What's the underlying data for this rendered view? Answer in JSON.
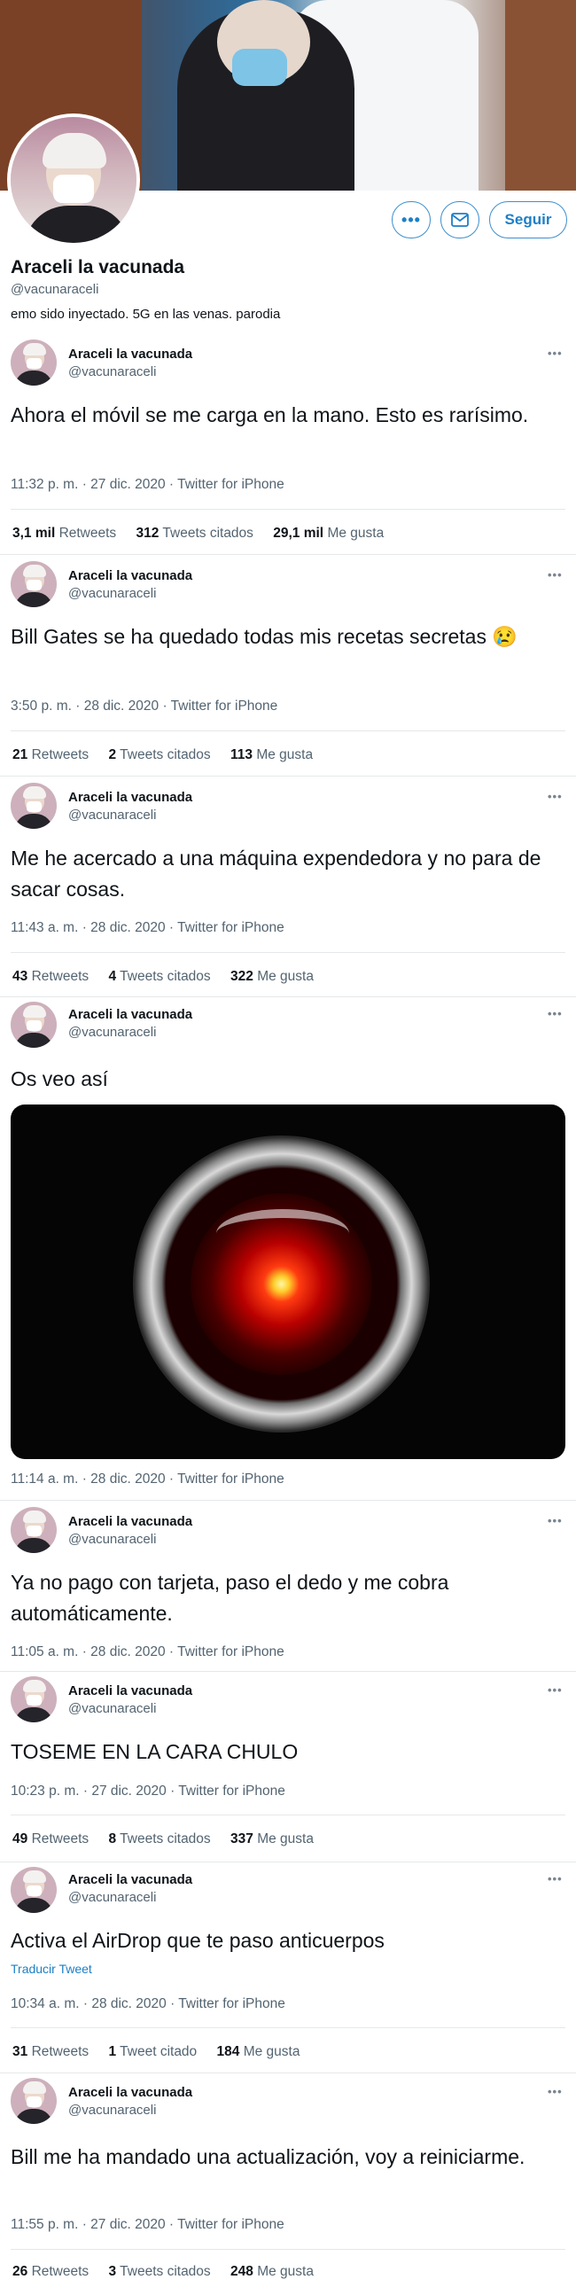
{
  "profile": {
    "name": "Araceli la vacunada",
    "handle": "@vacunaraceli",
    "bio": "emo sido inyectado. 5G en las venas. parodia",
    "follow_label": "Seguir",
    "more_label": "•••"
  },
  "tweets": [
    {
      "name": "Araceli la vacunada",
      "handle": "@vacunaraceli",
      "text": "Ahora el móvil se me carga en la mano. Esto es rarísimo.",
      "meta": "11:32 p. m. · 27 dic. 2020 · Twitter for iPhone",
      "retweets": "3,1 mil",
      "retweets_label": "Retweets",
      "quotes": "312",
      "quotes_label": "Tweets citados",
      "likes": "29,1 mil",
      "likes_label": "Me gusta"
    },
    {
      "name": "Araceli la vacunada",
      "handle": "@vacunaraceli",
      "text": "Bill Gates se ha quedado todas mis recetas secretas 😢",
      "meta": "3:50 p. m. · 28 dic. 2020 · Twitter for iPhone",
      "retweets": "21",
      "retweets_label": "Retweets",
      "quotes": "2",
      "quotes_label": "Tweets citados",
      "likes": "113",
      "likes_label": "Me gusta"
    },
    {
      "name": "Araceli la vacunada",
      "handle": "@vacunaraceli",
      "text": "Me he acercado a una máquina expendedora y no para de sacar cosas.",
      "meta": "11:43 a. m. · 28 dic. 2020 · Twitter for iPhone",
      "retweets": "43",
      "retweets_label": "Retweets",
      "quotes": "4",
      "quotes_label": "Tweets citados",
      "likes": "322",
      "likes_label": "Me gusta"
    },
    {
      "name": "Araceli la vacunada",
      "handle": "@vacunaraceli",
      "text": "Os veo así",
      "meta": "11:14 a. m. · 28 dic. 2020 · Twitter for iPhone"
    },
    {
      "name": "Araceli la vacunada",
      "handle": "@vacunaraceli",
      "text": "Ya no pago con tarjeta, paso el dedo y me cobra automáticamente.",
      "meta": "11:05 a. m. · 28 dic. 2020 · Twitter for iPhone"
    },
    {
      "name": "Araceli la vacunada",
      "handle": "@vacunaraceli",
      "text": "TOSEME EN LA CARA CHULO",
      "meta": "10:23 p. m. · 27 dic. 2020 · Twitter for iPhone",
      "retweets": "49",
      "retweets_label": "Retweets",
      "quotes": "8",
      "quotes_label": "Tweets citados",
      "likes": "337",
      "likes_label": "Me gusta"
    },
    {
      "name": "Araceli la vacunada",
      "handle": "@vacunaraceli",
      "text": "Activa el AirDrop que te paso anticuerpos",
      "translate": "Traducir Tweet",
      "meta": "10:34 a. m. · 28 dic. 2020 · Twitter for iPhone",
      "retweets": "31",
      "retweets_label": "Retweets",
      "quotes": "1",
      "quotes_label": "Tweet citado",
      "likes": "184",
      "likes_label": "Me gusta"
    },
    {
      "name": "Araceli la vacunada",
      "handle": "@vacunaraceli",
      "text": "Bill me ha mandado una actualización, voy a reiniciarme.",
      "meta": "11:55 p. m. · 27 dic. 2020 · Twitter for iPhone",
      "retweets": "26",
      "retweets_label": "Retweets",
      "quotes": "3",
      "quotes_label": "Tweets citados",
      "likes": "248",
      "likes_label": "Me gusta"
    }
  ],
  "icons": {
    "more": "more-dots-icon",
    "mail": "mail-icon"
  },
  "colors": {
    "accent": "#1d7fc7",
    "muted": "#536471",
    "hal_red": "#ff3b10"
  }
}
